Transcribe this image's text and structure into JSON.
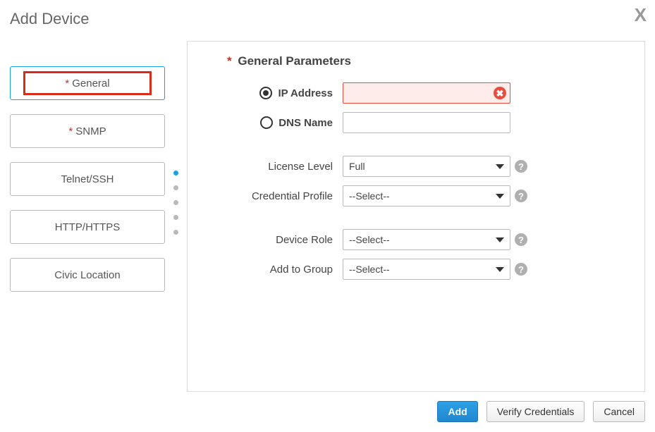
{
  "title": "Add Device",
  "tabs": {
    "general": "General",
    "snmp": "SNMP",
    "telnet": "Telnet/SSH",
    "http": "HTTP/HTTPS",
    "civic": "Civic Location"
  },
  "panel": {
    "heading": "General Parameters",
    "labels": {
      "ip": "IP Address",
      "dns": "DNS Name",
      "license": "License Level",
      "credential": "Credential Profile",
      "role": "Device Role",
      "group": "Add to Group"
    },
    "values": {
      "ip": "",
      "dns": "",
      "license": "Full",
      "credential": "--Select--",
      "role": "--Select--",
      "group": "--Select--"
    }
  },
  "footer": {
    "add": "Add",
    "verify": "Verify Credentials",
    "cancel": "Cancel"
  },
  "glyphs": {
    "required": "*",
    "help": "?",
    "close": "X",
    "err": "✖"
  }
}
